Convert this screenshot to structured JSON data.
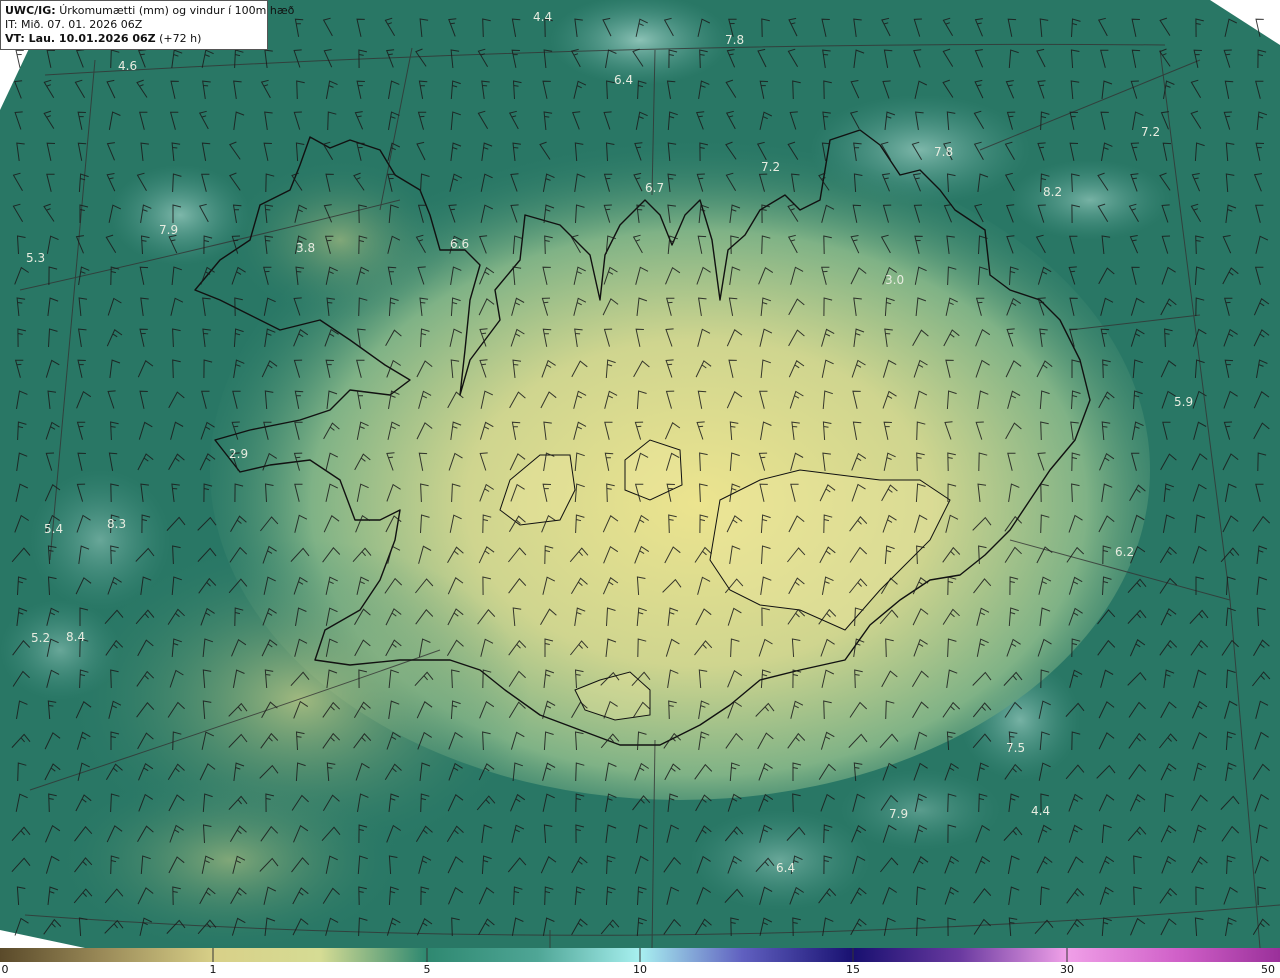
{
  "header": {
    "model_code": "UWC/IG:",
    "title": "Úrkomumætti (mm) og vindur í 100m hæð",
    "initial_time": "IT: Mið. 07. 01. 2026 06Z",
    "valid_prefix": "VT: Lau. 10.01.2026 06Z",
    "valid_suffix": "(+72 h)"
  },
  "map_values": [
    {
      "text": "4.4"
    },
    {
      "text": "7.8"
    },
    {
      "text": "4.6"
    },
    {
      "text": "6.4"
    },
    {
      "text": "7.2"
    },
    {
      "text": "7.2"
    },
    {
      "text": "7.8"
    },
    {
      "text": "6.7"
    },
    {
      "text": "8.2"
    },
    {
      "text": "7.9"
    },
    {
      "text": "3.8"
    },
    {
      "text": "6.6"
    },
    {
      "text": "5.3"
    },
    {
      "text": "3.0"
    },
    {
      "text": "5.9"
    },
    {
      "text": "2.9"
    },
    {
      "text": "5.4"
    },
    {
      "text": "8.3"
    },
    {
      "text": "6.2"
    },
    {
      "text": "5.2"
    },
    {
      "text": "8.4"
    },
    {
      "text": "7.5"
    },
    {
      "text": "4.4"
    },
    {
      "text": "7.9"
    },
    {
      "text": "6.4"
    }
  ],
  "colorbar": {
    "ticks": [
      "0",
      "1",
      "5",
      "10",
      "15",
      "30",
      "50"
    ],
    "colors": [
      "#5a4a2a",
      "#b8a868",
      "#ece890",
      "#9ec8a0",
      "#2e8870",
      "#3a9a88",
      "#a8f0f0",
      "#2020a0",
      "#181070",
      "#7030a0",
      "#e060d0",
      "#b040b0"
    ]
  },
  "colors": {
    "sea": "#2f7f6c",
    "land_high": "#e6df8e",
    "land_mid": "#8fba8a",
    "coast": "#111111",
    "barb": "#1a1a1a",
    "grid": "#333333"
  }
}
